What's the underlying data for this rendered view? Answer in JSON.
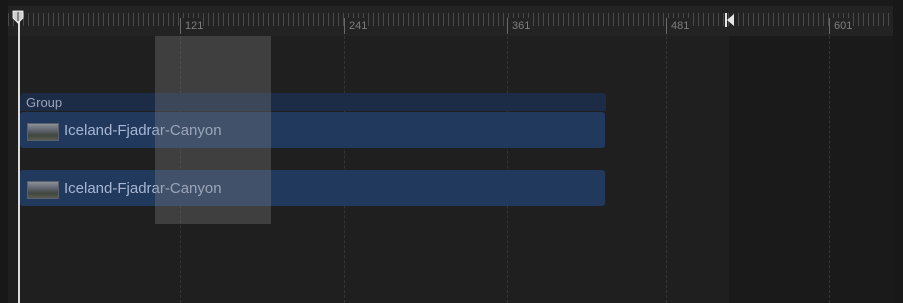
{
  "ruler": {
    "labels": [
      "121",
      "241",
      "361",
      "481",
      "601"
    ]
  },
  "group": {
    "label": "Group"
  },
  "clips": [
    {
      "name": "Iceland-Fjadrar-Canyon",
      "thumbnail": "canyon-thumbnail"
    },
    {
      "name": "Iceland-Fjadrar-Canyon",
      "thumbnail": "canyon-thumbnail"
    }
  ],
  "colors": {
    "background": "#1e1e1f",
    "clip": "#22395e",
    "group": "#1c2b46",
    "clip_text": "#a7b7d3",
    "selection": "rgba(130,130,130,0.33)",
    "playhead": "#dcdcdc"
  },
  "icons": {
    "playhead": "playhead-icon",
    "end_marker": "play-range-end-icon"
  }
}
